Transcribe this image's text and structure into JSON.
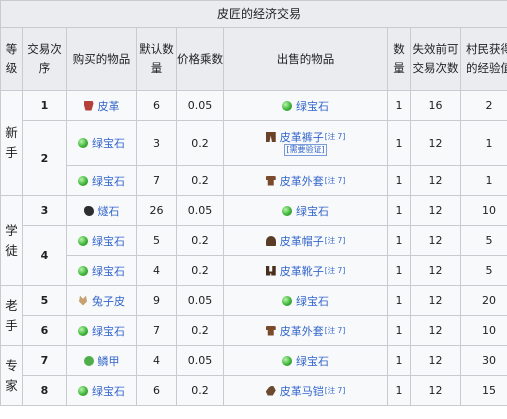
{
  "title": "皮匠的经济交易",
  "headers": [
    "等级",
    "交易次序",
    "购买的物品",
    "默认数量",
    "价格乘数",
    "出售的物品",
    "数量",
    "失效前可交易次数",
    "村民获得的经验值"
  ],
  "tiers": [
    "新手",
    "学徒",
    "老手",
    "专家"
  ],
  "note_label": "[注 7]",
  "rows": [
    {
      "order": "1",
      "buy": "皮革",
      "buy_icon": "leather-icon",
      "qty": "6",
      "mult": "0.05",
      "sell": "绿宝石",
      "sell_icon": "emerald-icon",
      "sell_note": "",
      "sell_sub": "",
      "sqty": "1",
      "uses": "16",
      "xp": "2"
    },
    {
      "order": "2",
      "buy": "绿宝石",
      "buy_icon": "emerald-icon",
      "qty": "3",
      "mult": "0.2",
      "sell": "皮革裤子",
      "sell_icon": "leather-pants-icon",
      "sell_note": "[注 7]",
      "sell_sub": "[需要验证]",
      "sqty": "1",
      "uses": "12",
      "xp": "1"
    },
    {
      "order": "",
      "buy": "绿宝石",
      "buy_icon": "emerald-icon",
      "qty": "7",
      "mult": "0.2",
      "sell": "皮革外套",
      "sell_icon": "leather-tunic-icon",
      "sell_note": "[注 7]",
      "sell_sub": "",
      "sqty": "1",
      "uses": "12",
      "xp": "1"
    },
    {
      "order": "3",
      "buy": "燧石",
      "buy_icon": "flint-icon",
      "qty": "26",
      "mult": "0.05",
      "sell": "绿宝石",
      "sell_icon": "emerald-icon",
      "sell_note": "",
      "sell_sub": "",
      "sqty": "1",
      "uses": "12",
      "xp": "10"
    },
    {
      "order": "4",
      "buy": "绿宝石",
      "buy_icon": "emerald-icon",
      "qty": "5",
      "mult": "0.2",
      "sell": "皮革帽子",
      "sell_icon": "leather-cap-icon",
      "sell_note": "[注 7]",
      "sell_sub": "",
      "sqty": "1",
      "uses": "12",
      "xp": "5"
    },
    {
      "order": "",
      "buy": "绿宝石",
      "buy_icon": "emerald-icon",
      "qty": "4",
      "mult": "0.2",
      "sell": "皮革靴子",
      "sell_icon": "leather-boots-icon",
      "sell_note": "[注 7]",
      "sell_sub": "",
      "sqty": "1",
      "uses": "12",
      "xp": "5"
    },
    {
      "order": "5",
      "buy": "兔子皮",
      "buy_icon": "rabbit-hide-icon",
      "qty": "9",
      "mult": "0.05",
      "sell": "绿宝石",
      "sell_icon": "emerald-icon",
      "sell_note": "",
      "sell_sub": "",
      "sqty": "1",
      "uses": "12",
      "xp": "20"
    },
    {
      "order": "6",
      "buy": "绿宝石",
      "buy_icon": "emerald-icon",
      "qty": "7",
      "mult": "0.2",
      "sell": "皮革外套",
      "sell_icon": "leather-tunic-icon",
      "sell_note": "[注 7]",
      "sell_sub": "",
      "sqty": "1",
      "uses": "12",
      "xp": "10"
    },
    {
      "order": "7",
      "buy": "鳞甲",
      "buy_icon": "scute-icon",
      "qty": "4",
      "mult": "0.05",
      "sell": "绿宝石",
      "sell_icon": "emerald-icon",
      "sell_note": "",
      "sell_sub": "",
      "sqty": "1",
      "uses": "12",
      "xp": "30"
    },
    {
      "order": "8",
      "buy": "绿宝石",
      "buy_icon": "emerald-icon",
      "qty": "6",
      "mult": "0.2",
      "sell": "皮革马铠",
      "sell_icon": "leather-horse-armor-icon",
      "sell_note": "[注 7]",
      "sell_sub": "",
      "sqty": "1",
      "uses": "12",
      "xp": "15"
    }
  ]
}
